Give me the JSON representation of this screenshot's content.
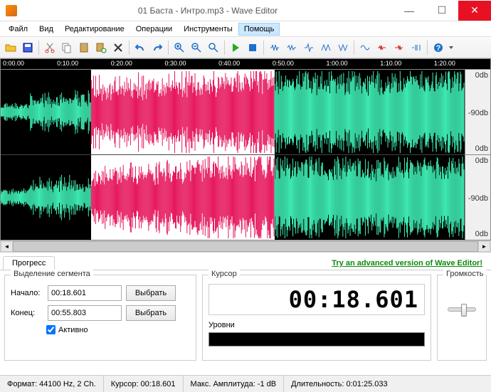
{
  "title": "01 Баста - Интро.mp3 - Wave Editor",
  "menu": {
    "file": "Файл",
    "view": "Вид",
    "edit": "Редактирование",
    "ops": "Операции",
    "tools": "Инструменты",
    "help": "Помощь"
  },
  "ruler": [
    "0:00.00",
    "0:10.00",
    "0:20.00",
    "0:30.00",
    "0:40.00",
    "0:50.00",
    "1:00.00",
    "1:10.00",
    "1:20.00"
  ],
  "db": {
    "top": "0db",
    "mid": "-90db",
    "bot": "0db"
  },
  "tabs": {
    "progress": "Прогресс"
  },
  "adv_link": "Try an advanced version of Wave Editor!",
  "segment": {
    "title": "Выделение сегмента",
    "start_label": "Начало:",
    "start_value": "00:18.601",
    "end_label": "Конец:",
    "end_value": "00:55.803",
    "select_btn": "Выбрать",
    "active": "Активно"
  },
  "cursor": {
    "title": "Курсор",
    "value": "00:18.601",
    "levels": "Уровни"
  },
  "volume": {
    "title": "Громкость"
  },
  "status": {
    "format": "Формат: 44100 Hz, 2 Ch.",
    "cursor": "Курсор: 00:18.601",
    "amp": "Макс. Амплитуда: -1 dB",
    "dur": "Длительность: 0:01:25.033"
  },
  "colors": {
    "wave": "#3de8b0",
    "sel": "#e6195f"
  }
}
